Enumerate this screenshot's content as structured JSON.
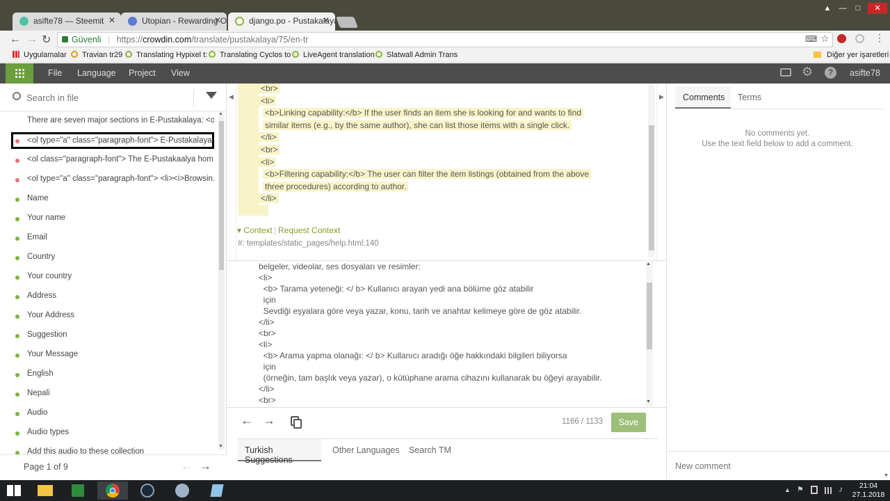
{
  "browser": {
    "tabs": [
      {
        "title": "asifte78 — Steemit",
        "close": "✕"
      },
      {
        "title": "Utopian - Rewarding Op",
        "close": "✕"
      },
      {
        "title": "django.po - Pustakalaya",
        "close": "✕"
      }
    ],
    "security_label": "Güvenli",
    "url_prefix": "https://",
    "url_host": "crowdin.com",
    "url_path": "/translate/pustakalaya/75/en-tr",
    "bookmarks": [
      "Uygulamalar",
      "Travian tr29",
      "Translating Hypixel t:",
      "Translating Cyclos to",
      "LiveAgent translation",
      "Slatwall Admin Trans"
    ],
    "other_bookmarks": "Diğer yer işaretleri"
  },
  "appbar": {
    "menus": [
      "File",
      "Language",
      "Project",
      "View"
    ],
    "user": "asifte78"
  },
  "left": {
    "search_placeholder": "Search in file",
    "items": [
      {
        "text": "There are seven major sections in E-Pustakalaya: <ol...",
        "status": "none"
      },
      {
        "text": "<ol type=\"a\" class=\"paragraph-font\"> E-Pustakalaya ...",
        "status": "red"
      },
      {
        "text": "<ol class=\"paragraph-font\"> The E-Pustakaalya hom...",
        "status": "red"
      },
      {
        "text": "<ol type=\"a\" class=\"paragraph-font\"> <li><i>Browsin...",
        "status": "red"
      },
      {
        "text": "Name",
        "status": "green"
      },
      {
        "text": "Your name",
        "status": "green"
      },
      {
        "text": "Email",
        "status": "green"
      },
      {
        "text": "Country",
        "status": "green"
      },
      {
        "text": "Your country",
        "status": "green"
      },
      {
        "text": "Address",
        "status": "green"
      },
      {
        "text": "Your Address",
        "status": "green"
      },
      {
        "text": "Suggestion",
        "status": "green"
      },
      {
        "text": "Your Message",
        "status": "green"
      },
      {
        "text": "English",
        "status": "green"
      },
      {
        "text": "Nepali",
        "status": "green"
      },
      {
        "text": "Audio",
        "status": "green"
      },
      {
        "text": "Audio types",
        "status": "green"
      },
      {
        "text": "Add this audio to these collection",
        "status": "green"
      }
    ],
    "page_label": "Page 1 of 9"
  },
  "source": {
    "lines": [
      "<br>",
      "<li>",
      "<b>Linking capability:</b> If the user finds an item she is looking for and wants to find",
      "similar items (e.g., by the same author), she can list those items with a single click.",
      "</li>",
      "<br>",
      "<li>",
      "<b>Filtering capability:</b> The user can filter the item listings (obtained from the above",
      "three procedures) according to author.",
      "</li>",
      ""
    ],
    "context_label": "Context",
    "request_context": "Request Context",
    "context_path": "#: templates/static_pages/help.html:140"
  },
  "translation": {
    "lines": [
      "belgeler, videolar, ses dosyaları ve resimler:",
      "<li>",
      "  <b> Tarama yeteneği: </ b> Kullanıcı arayan yedi ana bölüme göz atabilir",
      "  için",
      "  Sevdiği eşyalara göre veya yazar, konu, tarih ve anahtar kelimeye göre de göz atabilir.",
      "</li>",
      "<br>",
      "<li>",
      "  <b> Arama yapma olanağı: </ b> Kullanıcı aradığı öğe hakkındaki bilgileri biliyorsa",
      "  için",
      "  (örneğin, tam başlık veya yazar), o kütüphane arama cihazını kullanarak bu öğeyi arayabilir.",
      "</li>",
      "<br>"
    ],
    "char_count": "1166 / 1133",
    "save_label": "Save"
  },
  "bottom_tabs": [
    "Turkish Suggestions",
    "Other Languages",
    "Search TM"
  ],
  "right": {
    "tabs": [
      "Comments",
      "Terms"
    ],
    "empty_line1": "No comments yet.",
    "empty_line2": "Use the text field below to add a comment.",
    "new_comment_placeholder": "New comment"
  },
  "taskbar": {
    "time": "21:04",
    "date": "27.1.2018"
  },
  "colors": {
    "accent": "#6b9e3c",
    "highlight": "#f9f4c8",
    "save": "#9cbf7a"
  }
}
